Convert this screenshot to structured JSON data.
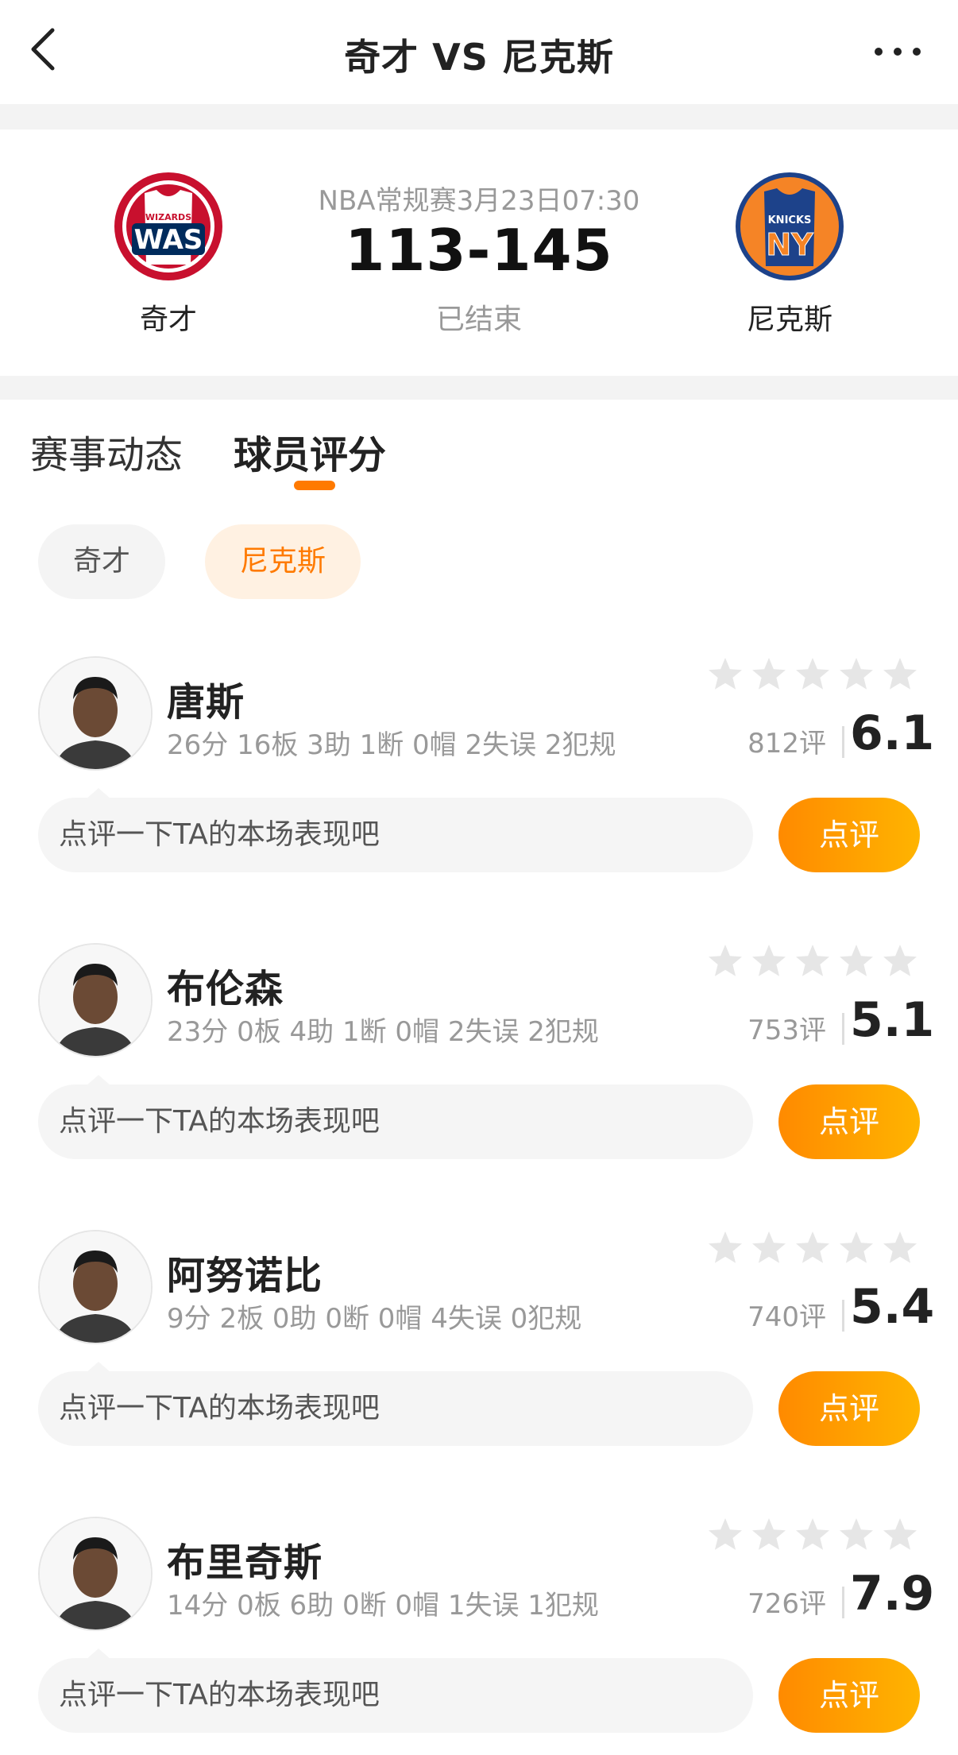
{
  "nav": {
    "title": "奇才 VS 尼克斯",
    "back_icon": "chevron-left-icon",
    "more_icon": "more-horizontal-icon"
  },
  "match": {
    "info": "NBA常规赛3月23日07:30",
    "score": "113-145",
    "status": "已结束",
    "home": {
      "name": "奇才",
      "logo_text": "WAS",
      "logo_subtext": "WIZARDS",
      "color": "#c8102e"
    },
    "away": {
      "name": "尼克斯",
      "logo_text": "NY",
      "logo_subtext": "KNICKS",
      "color": "#1d428a"
    }
  },
  "tabs": [
    {
      "label": "赛事动态",
      "active": false
    },
    {
      "label": "球员评分",
      "active": true
    }
  ],
  "team_filter": [
    {
      "label": "奇才",
      "selected": false
    },
    {
      "label": "尼克斯",
      "selected": true
    }
  ],
  "players": [
    {
      "name": "唐斯",
      "stats": "26分 16板 3助 1断 0帽 2失误 2犯规",
      "reviews": "812评",
      "rating": "6.1",
      "comment_placeholder": "点评一下TA的本场表现吧",
      "comment_button": "点评"
    },
    {
      "name": "布伦森",
      "stats": "23分 0板 4助 1断 0帽 2失误 2犯规",
      "reviews": "753评",
      "rating": "5.1",
      "comment_placeholder": "点评一下TA的本场表现吧",
      "comment_button": "点评"
    },
    {
      "name": "阿努诺比",
      "stats": "9分 2板 0助 0断 0帽 4失误 0犯规",
      "reviews": "740评",
      "rating": "5.4",
      "comment_placeholder": "点评一下TA的本场表现吧",
      "comment_button": "点评"
    },
    {
      "name": "布里奇斯",
      "stats": "14分 0板 6助 0断 0帽 1失误 1犯规",
      "reviews": "726评",
      "rating": "7.9",
      "comment_placeholder": "点评一下TA的本场表现吧",
      "comment_button": "点评"
    }
  ],
  "colors": {
    "accent": "#ff7a00",
    "star": "#e6e6e6"
  }
}
